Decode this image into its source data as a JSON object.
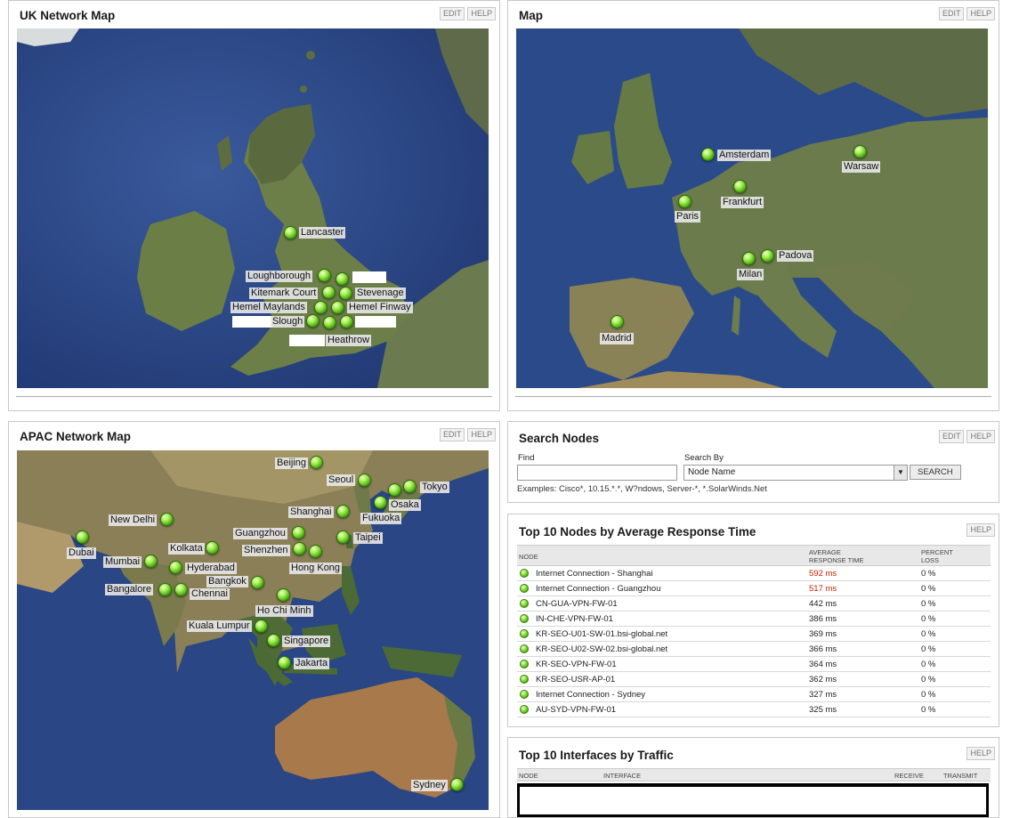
{
  "uk_map": {
    "title": "UK Network Map",
    "edit_label": "EDIT",
    "help_label": "HELP",
    "labels": {
      "lancaster": "Lancaster",
      "loughborough": "Loughborough",
      "kitemark": "Kitemark Court",
      "stevenage": "Stevenage",
      "hemel_maylands": "Hemel Maylands",
      "hemel_finway": "Hemel Finway",
      "slough": "Slough",
      "heathrow": "Heathrow"
    }
  },
  "europe_map": {
    "title": "Map",
    "edit_label": "EDIT",
    "help_label": "HELP",
    "labels": {
      "amsterdam": "Amsterdam",
      "warsaw": "Warsaw",
      "paris": "Paris",
      "frankfurt": "Frankfurt",
      "padova": "Padova",
      "milan": "Milan",
      "madrid": "Madrid"
    }
  },
  "apac_map": {
    "title": "APAC Network Map",
    "edit_label": "EDIT",
    "help_label": "HELP",
    "labels": {
      "beijing": "Beijing",
      "seoul": "Seoul",
      "tokyo": "Tokyo",
      "osaka": "Osaka",
      "new_delhi": "New Delhi",
      "shanghai": "Shanghai",
      "fukuoka": "Fukuoka",
      "guangzhou": "Guangzhou",
      "dubai": "Dubai",
      "kolkata": "Kolkata",
      "taipei": "Taipei",
      "shenzhen": "Shenzhen",
      "mumbai": "Mumbai",
      "hyderabad": "Hyderabad",
      "hong_kong": "Hong Kong",
      "bangkok": "Bangkok",
      "bangalore": "Bangalore",
      "chennai": "Chennai",
      "ho_chi_minh": "Ho Chi Minh",
      "kuala_lumpur": "Kuala Lumpur",
      "singapore": "Singapore",
      "jakarta": "Jakarta",
      "sydney": "Sydney"
    }
  },
  "search": {
    "title": "Search Nodes",
    "edit_label": "EDIT",
    "help_label": "HELP",
    "find_label": "Find",
    "find_value": "",
    "search_by_label": "Search By",
    "search_by_value": "Node Name",
    "button_label": "SEARCH",
    "examples": "Examples: Cisco*, 10.15.*.*, W?ndows, Server-*, *.SolarWinds.Net"
  },
  "top_nodes": {
    "title": "Top 10 Nodes by Average Response Time",
    "help_label": "HELP",
    "col_node": "NODE",
    "col_avg_1": "AVERAGE",
    "col_avg_2": "RESPONSE TIME",
    "col_loss_1": "PERCENT",
    "col_loss_2": "LOSS",
    "rows": [
      {
        "node": "Internet Connection - Shanghai",
        "time": "592 ms",
        "loss": "0 %"
      },
      {
        "node": "Internet Connection - Guangzhou",
        "time": "517 ms",
        "loss": "0 %"
      },
      {
        "node": "CN-GUA-VPN-FW-01",
        "time": "442 ms",
        "loss": "0 %"
      },
      {
        "node": "IN-CHE-VPN-FW-01",
        "time": "386 ms",
        "loss": "0 %"
      },
      {
        "node": "KR-SEO-U01-SW-01.bsi-global.net",
        "time": "369 ms",
        "loss": "0 %"
      },
      {
        "node": "KR-SEO-U02-SW-02.bsi-global.net",
        "time": "366 ms",
        "loss": "0 %"
      },
      {
        "node": "KR-SEO-VPN-FW-01",
        "time": "364 ms",
        "loss": "0 %"
      },
      {
        "node": "KR-SEO-USR-AP-01",
        "time": "362 ms",
        "loss": "0 %"
      },
      {
        "node": "Internet Connection - Sydney",
        "time": "327 ms",
        "loss": "0 %"
      },
      {
        "node": "AU-SYD-VPN-FW-01",
        "time": "325 ms",
        "loss": "0 %"
      }
    ],
    "warn_color": "#cc2200"
  },
  "top_interfaces": {
    "title": "Top 10 Interfaces by Traffic",
    "help_label": "HELP",
    "col_node": "NODE",
    "col_interface": "INTERFACE",
    "col_receive": "RECEIVE",
    "col_transmit": "TRANSMIT"
  },
  "colors": {
    "ocean": "#2f4a86",
    "node_green": "#6fd62a"
  }
}
